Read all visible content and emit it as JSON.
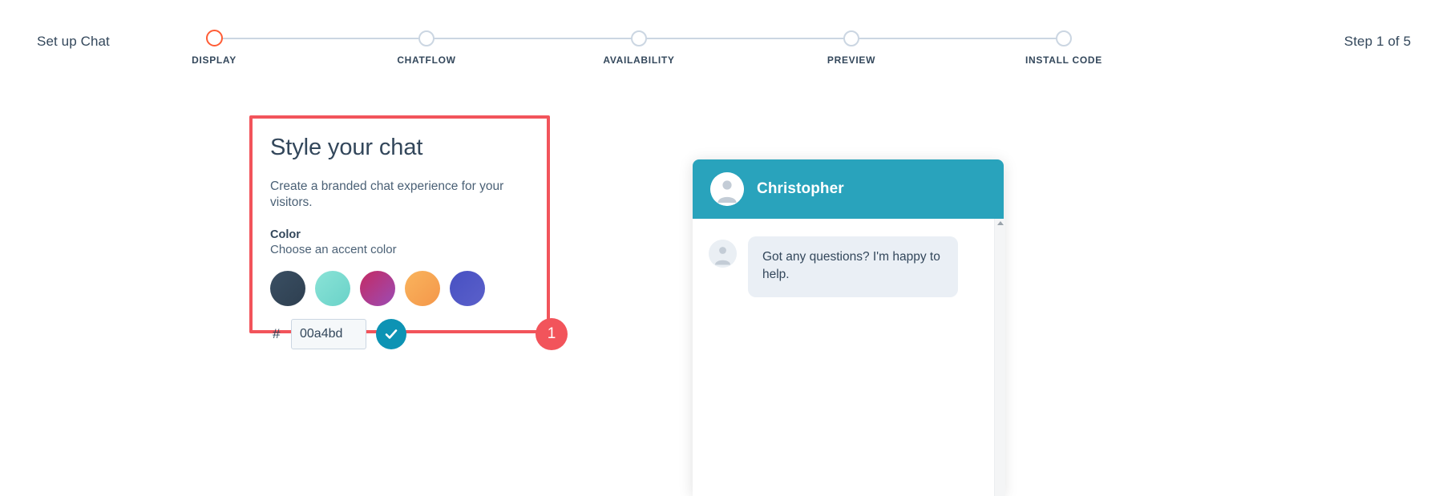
{
  "header": {
    "setup_label": "Set up Chat",
    "step_count": "Step 1 of 5",
    "steps": [
      {
        "label": "DISPLAY",
        "active": true
      },
      {
        "label": "CHATFLOW",
        "active": false
      },
      {
        "label": "AVAILABILITY",
        "active": false
      },
      {
        "label": "PREVIEW",
        "active": false
      },
      {
        "label": "INSTALL CODE",
        "active": false
      }
    ]
  },
  "card": {
    "title": "Style your chat",
    "subtitle": "Create a branded chat experience for your visitors.",
    "field_label": "Color",
    "field_hint": "Choose an accent color",
    "swatches": [
      {
        "name": "swatch-dark-navy",
        "from": "#3a4f63",
        "to": "#2e3f50"
      },
      {
        "name": "swatch-teal",
        "from": "#85e0d4",
        "to": "#6fd6cc"
      },
      {
        "name": "swatch-magenta",
        "from": "#c32b66",
        "to": "#9b4bb4"
      },
      {
        "name": "swatch-orange",
        "from": "#f8b05a",
        "to": "#f59a4a"
      },
      {
        "name": "swatch-indigo",
        "from": "#4a54c4",
        "to": "#5a5fc8"
      }
    ],
    "hash_symbol": "#",
    "hex_value": "00a4bd",
    "hex_placeholder": "00a4bd",
    "confirm_icon": "check-icon",
    "badge_number": "1",
    "accent_color": "#f2545b"
  },
  "chat_preview": {
    "agent_name": "Christopher",
    "header_color": "#29a3bc",
    "message": "Got any questions? I'm happy to help.",
    "avatar_icon": "person-avatar-icon",
    "scroll_arrow_icon": "scroll-up-arrow-icon"
  }
}
